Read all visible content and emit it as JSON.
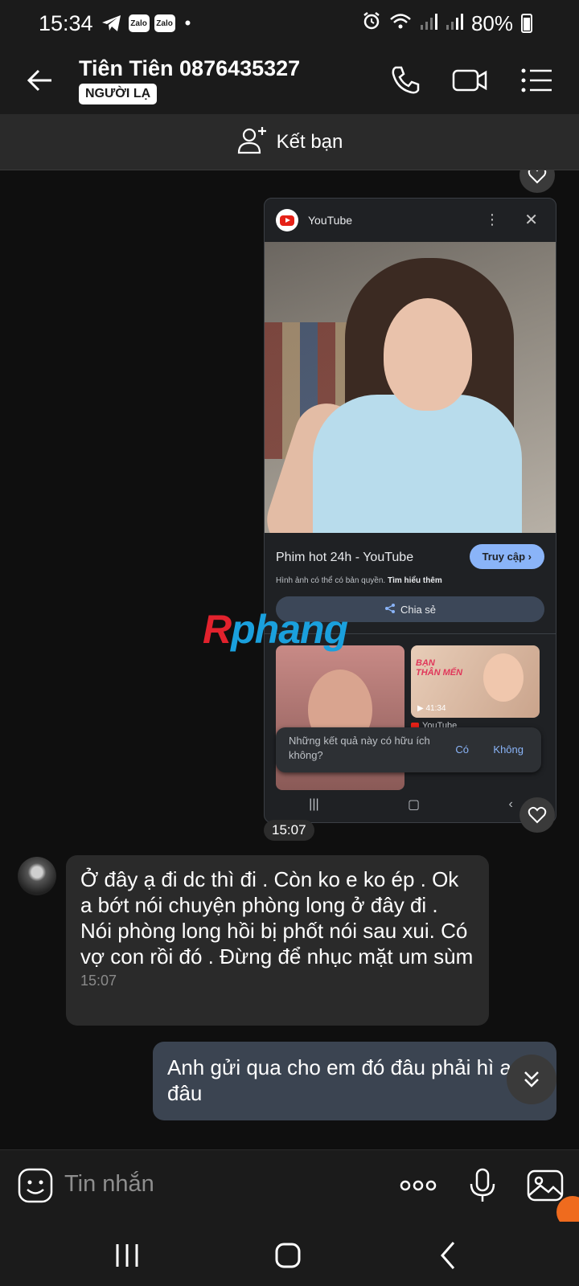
{
  "status_bar": {
    "time": "15:34",
    "zalo1": "Zalo",
    "zalo2": "Zalo",
    "battery": "80%"
  },
  "header": {
    "contact_name": "Tiên Tiên 0876435327",
    "badge": "NGƯỜI LẠ"
  },
  "add_friend": {
    "label": "Kết bạn"
  },
  "shared_screenshot": {
    "app_name": "YouTube",
    "page_title": "Phim hot 24h - YouTube",
    "visit_button": "Truy cập ›",
    "copyright": "Hình ảnh có thể có bản quyền.",
    "learn_more": "Tìm hiểu thêm",
    "share": "Chia sẻ",
    "thumb2_title_1": "BẠN",
    "thumb2_title_2": "THÂN MẾN",
    "thumb2_duration": "41:34",
    "thumb2_source": "YouTube",
    "feedback_question": "Những kết quả này có hữu ích không?",
    "feedback_yes": "Có",
    "feedback_no": "Không"
  },
  "watermark": {
    "r": "R",
    "rest": "phang"
  },
  "messages": {
    "time_separator": "15:07",
    "incoming_text": "Ở đây ạ đi dc thì đi . Còn ko e ko ép . Ok a bớt nói chuyện phòng long ở đây đi . Nói phòng long hồi bị phốt nói sau xui. Có vợ con rồi đó . Đừng để nhục mặt um sùm",
    "incoming_time": "15:07",
    "outgoing_text": "Anh gửi qua cho em đó đâu phải hì anh đâu"
  },
  "input": {
    "placeholder": "Tin nhắn"
  },
  "colors": {
    "accent_blue": "#8ab4f8",
    "outgoing_bubble": "#3b4451",
    "incoming_bubble": "#2a2a2a",
    "youtube_red": "#e52117"
  }
}
